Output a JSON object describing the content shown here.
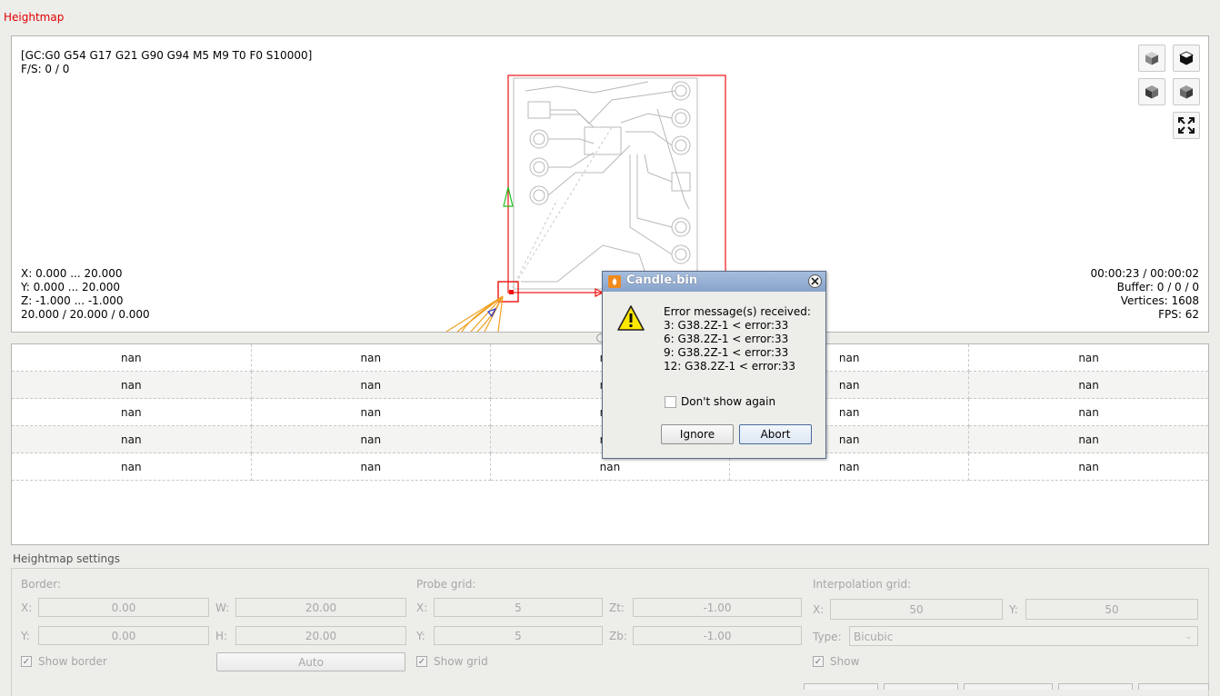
{
  "section": {
    "title": "Heightmap"
  },
  "viewport": {
    "gcode_state": "[GC:G0 G54 G17 G21 G90 G94 M5 M9 T0 F0 S10000]",
    "feed_speed": "F/S: 0 / 0",
    "x_range": "X: 0.000 ... 20.000",
    "y_range": "Y: 0.000 ... 20.000",
    "z_range": "Z: -1.000 ... -1.000",
    "dimensions": "20.000 / 20.000 / 0.000",
    "time": "00:00:23 / 00:00:02",
    "buffer": "Buffer: 0 / 0 / 0",
    "vertices": "Vertices: 1608",
    "fps": "FPS: 62",
    "view_buttons": [
      "isometric-view-icon",
      "top-view-icon",
      "front-view-icon",
      "left-view-icon",
      "fit-view-icon"
    ]
  },
  "table": {
    "rows": [
      [
        "nan",
        "nan",
        "nan",
        "nan",
        "nan"
      ],
      [
        "nan",
        "nan",
        "nan",
        "nan",
        "nan"
      ],
      [
        "nan",
        "nan",
        "nan",
        "nan",
        "nan"
      ],
      [
        "nan",
        "nan",
        "nan",
        "nan",
        "nan"
      ],
      [
        "nan",
        "nan",
        "nan",
        "nan",
        "nan"
      ]
    ]
  },
  "settings": {
    "title": "Heightmap settings",
    "border": {
      "label": "Border:",
      "x_label": "X:",
      "x_value": "0.00",
      "w_label": "W:",
      "w_value": "20.00",
      "y_label": "Y:",
      "y_value": "0.00",
      "h_label": "H:",
      "h_value": "20.00",
      "show_label": "Show border",
      "show_checked": true,
      "auto_label": "Auto"
    },
    "probe": {
      "label": "Probe grid:",
      "x_label": "X:",
      "x_value": "5",
      "zt_label": "Zt:",
      "zt_value": "-1.00",
      "y_label": "Y:",
      "y_value": "5",
      "zb_label": "Zb:",
      "zb_value": "-1.00",
      "show_label": "Show grid",
      "show_checked": true
    },
    "interpolation": {
      "label": "Interpolation grid:",
      "x_label": "X:",
      "x_value": "50",
      "y_label": "Y:",
      "y_value": "50",
      "type_label": "Type:",
      "type_value": "Bicubic",
      "show_label": "Show",
      "show_checked": true
    }
  },
  "dialog": {
    "title": "Candle.bin",
    "message": "Error message(s) received:\n3: G38.2Z-1 < error:33\n6: G38.2Z-1 < error:33\n9: G38.2Z-1 < error:33\n12: G38.2Z-1 < error:33",
    "dont_show_label": "Don't show again",
    "ignore_label": "Ignore",
    "abort_label": "Abort"
  },
  "colors": {
    "accent_red": "#e00000",
    "dialog_title": "#87a3cb"
  }
}
